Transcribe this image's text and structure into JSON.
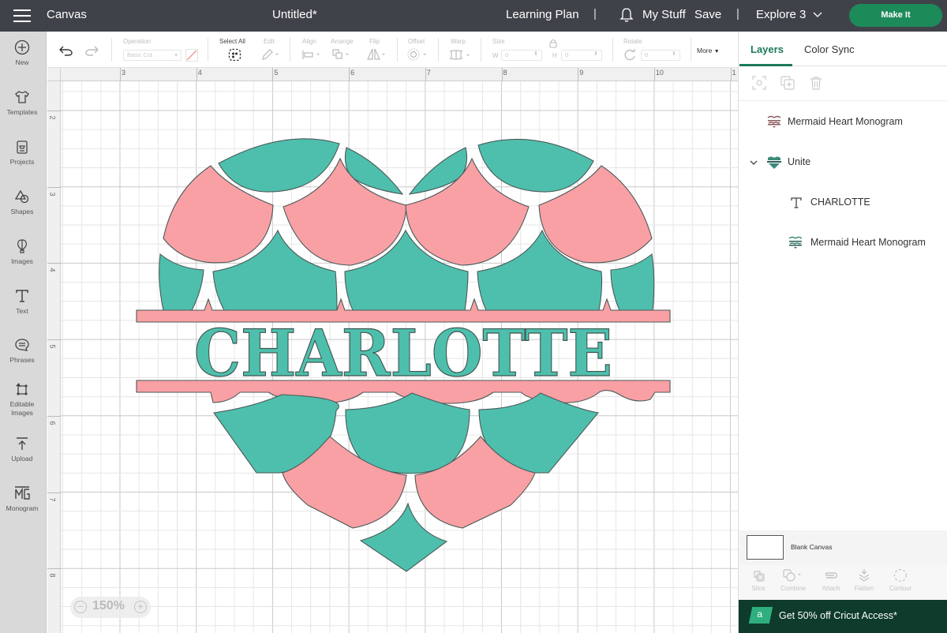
{
  "topbar": {
    "app_title": "Canvas",
    "doc_title": "Untitled*",
    "learning_plan": "Learning Plan",
    "separator": "|",
    "my_stuff": "My Stuff",
    "save": "Save",
    "machine": "Explore 3",
    "make_it": "Make It"
  },
  "sidebar": {
    "items": [
      {
        "label": "New",
        "icon": "plus-circle-icon"
      },
      {
        "label": "Templates",
        "icon": "tshirt-icon"
      },
      {
        "label": "Projects",
        "icon": "projects-icon"
      },
      {
        "label": "Shapes",
        "icon": "shapes-icon"
      },
      {
        "label": "Images",
        "icon": "balloon-icon"
      },
      {
        "label": "Text",
        "icon": "text-icon"
      },
      {
        "label": "Phrases",
        "icon": "speech-bubble-icon"
      },
      {
        "label": "Editable Images",
        "icon": "editable-image-icon"
      },
      {
        "label": "Upload",
        "icon": "upload-icon"
      },
      {
        "label": "Monogram",
        "icon": "monogram-icon"
      }
    ]
  },
  "toolbar": {
    "operation_label": "Operation",
    "operation_value": "Basic Cut",
    "select_all": "Select All",
    "edit": "Edit",
    "align": "Align",
    "arrange": "Arrange",
    "flip": "Flip",
    "offset": "Offset",
    "warp": "Warp",
    "size": "Size",
    "w_label": "W",
    "h_label": "H",
    "w_value": "0",
    "h_value": "0",
    "rotate": "Rotate",
    "rotate_value": "0",
    "more": "More"
  },
  "canvas": {
    "ruler_top": [
      "3",
      "4",
      "5",
      "6",
      "7",
      "8",
      "9",
      "10",
      "1"
    ],
    "ruler_left": [
      "2",
      "3",
      "4",
      "5",
      "6",
      "7",
      "8"
    ],
    "zoom_level": "150%",
    "design_text": "CHARLOTTE",
    "colors": {
      "teal": "#4fbfad",
      "pink": "#f9a0a5",
      "outline": "#4a5a57"
    }
  },
  "panel": {
    "tabs": [
      {
        "label": "Layers",
        "active": true
      },
      {
        "label": "Color Sync",
        "active": false
      }
    ],
    "layers": [
      {
        "name": "Mermaid Heart Monogram",
        "level": 0,
        "icon": "mermaid-heart-thumb"
      },
      {
        "name": "Unite",
        "level": 0,
        "icon": "unite-thumb",
        "expanded": true
      },
      {
        "name": "CHARLOTTE",
        "level": 1,
        "icon": "text-icon"
      },
      {
        "name": "Mermaid Heart Monogram",
        "level": 1,
        "icon": "mermaid-heart-thumb"
      }
    ],
    "blank_canvas": "Blank Canvas",
    "bottom_tools": [
      "Slice",
      "Combine",
      "Attach",
      "Flatten",
      "Contour"
    ],
    "promo_badge": "a",
    "promo": "Get 50% off Cricut Access*"
  }
}
